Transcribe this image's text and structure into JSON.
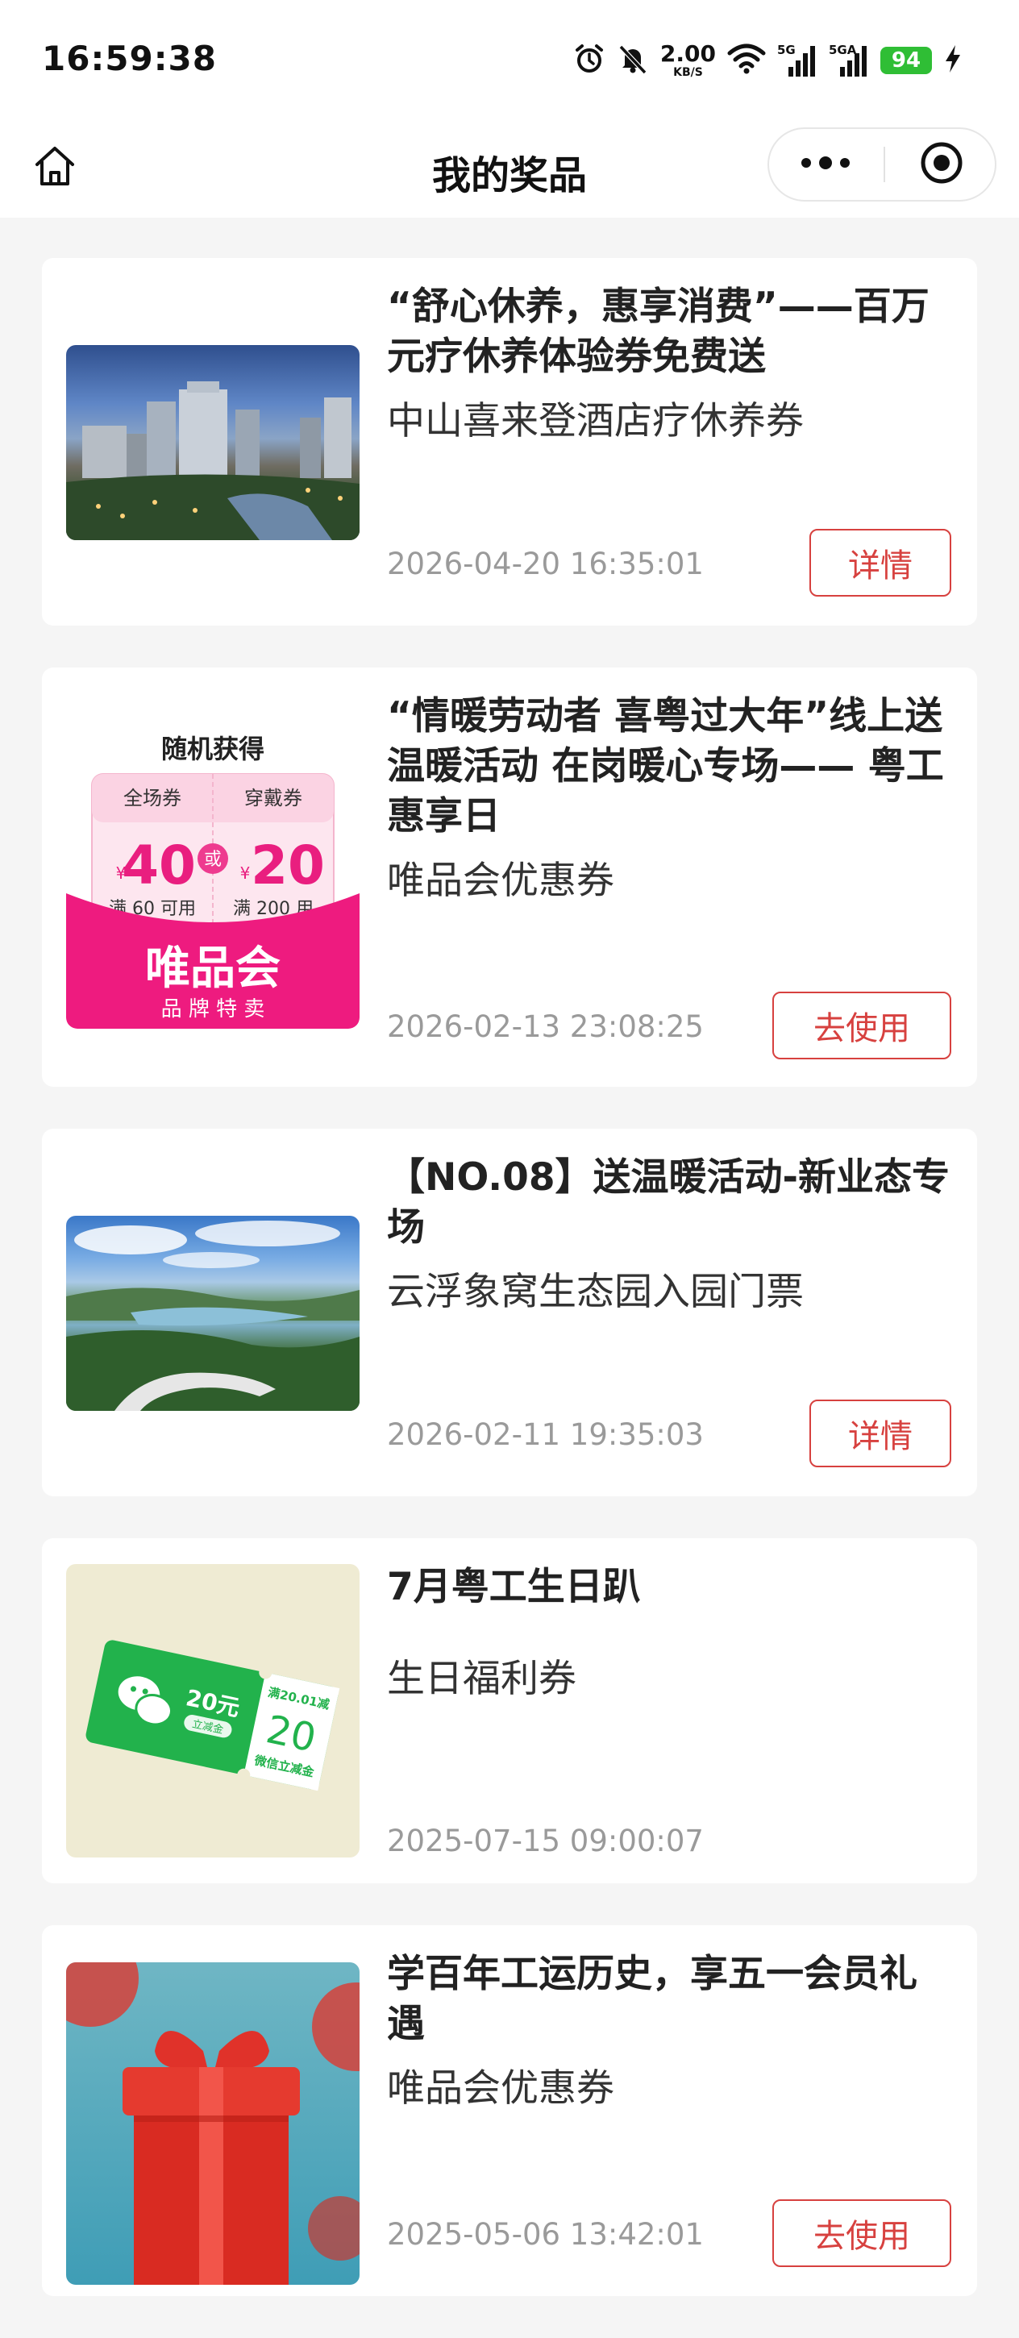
{
  "status_bar": {
    "time": "16:59:38",
    "net_speed_value": "2.00",
    "net_speed_unit": "KB/S",
    "battery": "94",
    "signal_1": "5G",
    "signal_2": "5GA"
  },
  "nav": {
    "title": "我的奖品"
  },
  "prizes": [
    {
      "title": "“舒心休养，惠享消费”——百万元疗休养体验券免费送",
      "subtitle": "中山喜来登酒店疗休养券",
      "date": "2026-04-20 16:35:01",
      "action": "详情"
    },
    {
      "title": "“情暖劳动者 喜粤过大年”线上送温暖活动 在岗暖心专场—— 粤工惠享日",
      "subtitle": "唯品会优惠券",
      "date": "2026-02-13 23:08:25",
      "action": "去使用",
      "image_text": {
        "headline": "随机获得",
        "ticket_a_label": "全场券",
        "ticket_a_amount": "40",
        "ticket_a_cond": "满 60 可用",
        "or": "或",
        "ticket_b_label": "穿戴券",
        "ticket_b_amount": "20",
        "ticket_b_cond": "满 200 用",
        "currency": "¥",
        "brand": "唯品会",
        "slogan": "品 牌 特 卖"
      }
    },
    {
      "title": "【NO.08】送温暖活动-新业态专场",
      "subtitle": "云浮象窝生态园入园门票",
      "date": "2026-02-11 19:35:03",
      "action": "详情"
    },
    {
      "title": "7月粤工生日趴",
      "subtitle": "生日福利券",
      "date": "2025-07-15 09:00:07",
      "action": "",
      "image_text": {
        "coupon_value": "20元",
        "coupon_tag": "立减金",
        "condition": "满20.01减",
        "amount": "20",
        "desc": "微信立减金"
      }
    },
    {
      "title": "学百年工运历史，享五一会员礼遇",
      "subtitle": "唯品会优惠券",
      "date": "2025-05-06 13:42:01",
      "action": "去使用"
    }
  ],
  "colors": {
    "accent_red": "#d7413f",
    "page_bg": "#f5f5f5",
    "card_bg": "#ffffff",
    "date_gray": "#9a9a9a",
    "battery_green": "#2fbe35",
    "wechat_green": "#22b24c",
    "vip_pink": "#ee1b7f"
  },
  "icons": {
    "home": "home-icon",
    "more": "more-dots-icon",
    "close": "target-circle-icon",
    "alarm": "alarm-icon",
    "mute": "bell-muted-icon",
    "wifi": "wifi-icon",
    "signal": "signal-bars-icon",
    "charging": "charging-bolt-icon"
  }
}
